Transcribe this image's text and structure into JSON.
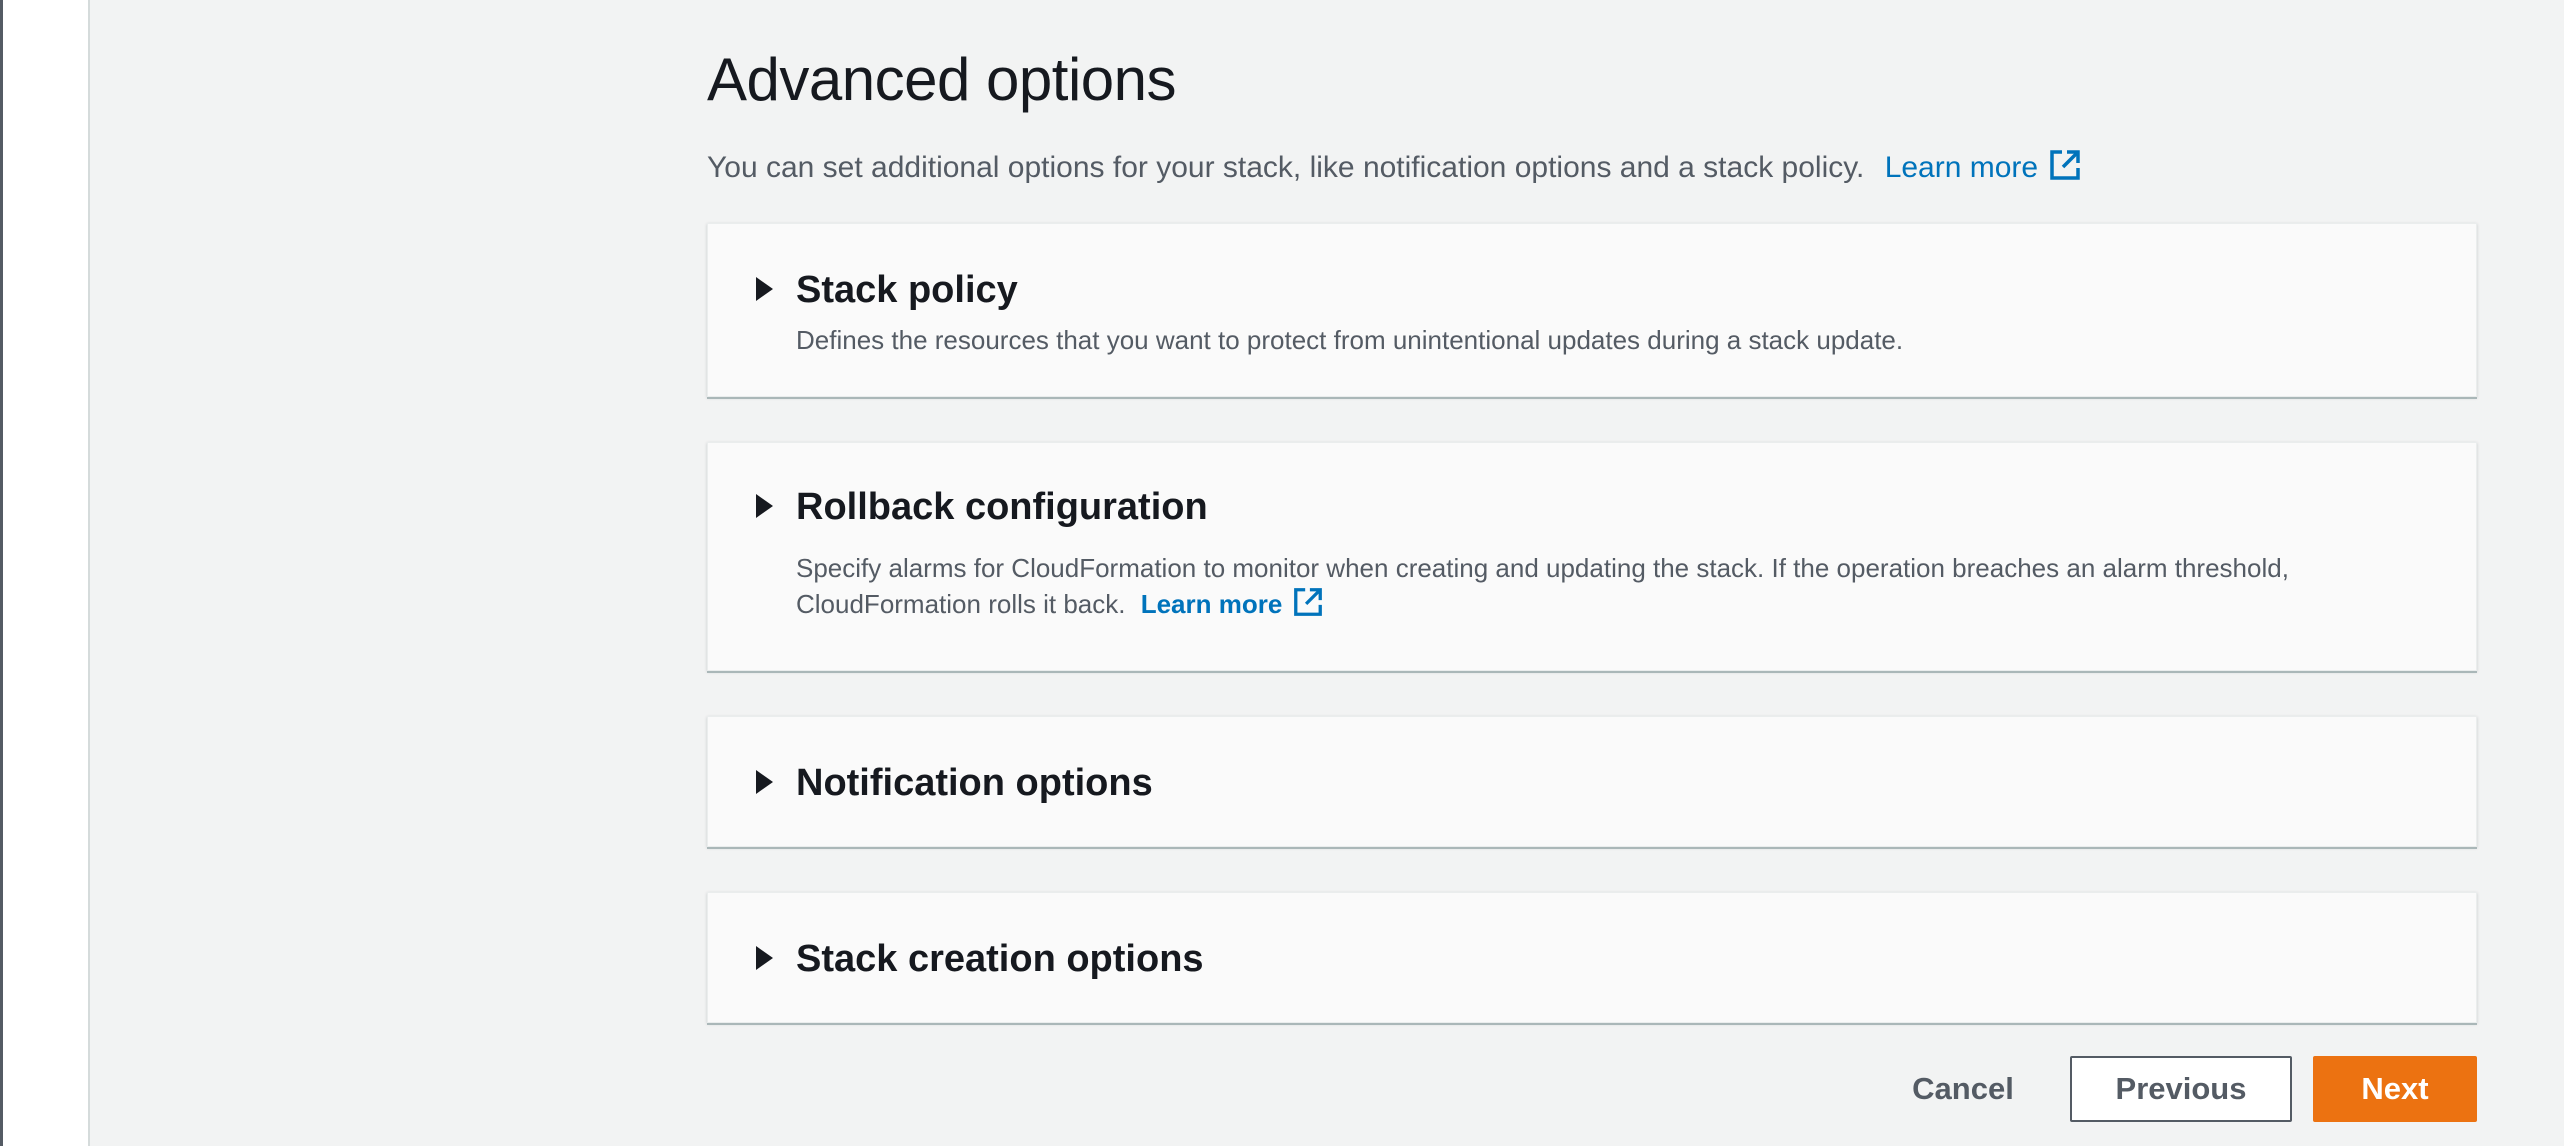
{
  "page": {
    "title": "Advanced options",
    "description": "You can set additional options for your stack, like notification options and a stack policy.",
    "learn_more": "Learn more"
  },
  "panels": [
    {
      "title": "Stack policy",
      "description": "Defines the resources that you want to protect from unintentional updates during a stack update.",
      "expanded": false
    },
    {
      "title": "Rollback configuration",
      "description": "Specify alarms for CloudFormation to monitor when creating and updating the stack. If the operation breaches an alarm threshold, CloudFormation rolls it back.",
      "learn_more": "Learn more",
      "expanded": false
    },
    {
      "title": "Notification options",
      "expanded": false
    },
    {
      "title": "Stack creation options",
      "expanded": false
    }
  ],
  "actions": {
    "cancel": "Cancel",
    "previous": "Previous",
    "next": "Next"
  },
  "icons": {
    "expand": "caret-right-icon",
    "external": "external-link-icon"
  },
  "colors": {
    "link": "#0073bb",
    "primary_button": "#ec7211",
    "background": "#f2f3f3",
    "panel": "#fafafa"
  }
}
